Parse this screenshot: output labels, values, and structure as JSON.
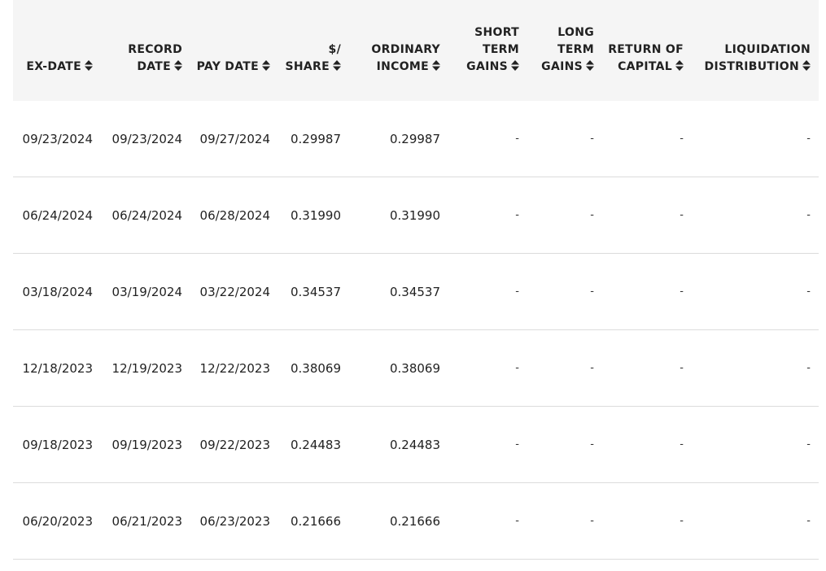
{
  "columns": [
    {
      "lines": [
        "EX-DATE"
      ]
    },
    {
      "lines": [
        "RECORD",
        "DATE"
      ]
    },
    {
      "lines": [
        "PAY DATE"
      ]
    },
    {
      "lines": [
        "$/",
        "SHARE"
      ]
    },
    {
      "lines": [
        "ORDINARY",
        "INCOME"
      ]
    },
    {
      "lines": [
        "SHORT",
        "TERM",
        "GAINS"
      ]
    },
    {
      "lines": [
        "LONG",
        "TERM",
        "GAINS"
      ]
    },
    {
      "lines": [
        "RETURN OF",
        "CAPITAL"
      ]
    },
    {
      "lines": [
        "LIQUIDATION",
        "DISTRIBUTION"
      ]
    }
  ],
  "icons": {
    "sort": "sort-updown-icon"
  },
  "rows": [
    [
      "09/23/2024",
      "09/23/2024",
      "09/27/2024",
      "0.29987",
      "0.29987",
      "-",
      "-",
      "-",
      "-"
    ],
    [
      "06/24/2024",
      "06/24/2024",
      "06/28/2024",
      "0.31990",
      "0.31990",
      "-",
      "-",
      "-",
      "-"
    ],
    [
      "03/18/2024",
      "03/19/2024",
      "03/22/2024",
      "0.34537",
      "0.34537",
      "-",
      "-",
      "-",
      "-"
    ],
    [
      "12/18/2023",
      "12/19/2023",
      "12/22/2023",
      "0.38069",
      "0.38069",
      "-",
      "-",
      "-",
      "-"
    ],
    [
      "09/18/2023",
      "09/19/2023",
      "09/22/2023",
      "0.24483",
      "0.24483",
      "-",
      "-",
      "-",
      "-"
    ],
    [
      "06/20/2023",
      "06/21/2023",
      "06/23/2023",
      "0.21666",
      "0.21666",
      "-",
      "-",
      "-",
      "-"
    ]
  ]
}
